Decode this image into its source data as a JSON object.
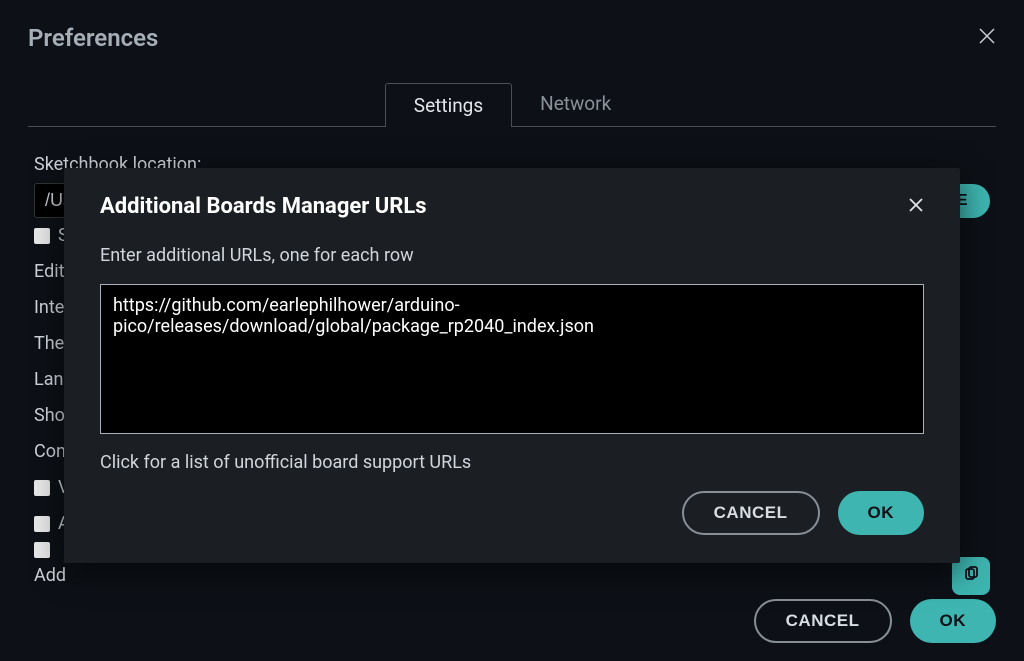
{
  "prefs": {
    "title": "Preferences",
    "tabs": {
      "settings": "Settings",
      "network": "Network"
    },
    "labels": {
      "sketchbook": "Sketchbook location:",
      "sketchbook_value": "/Us",
      "browse": "E",
      "show_files_check": "S",
      "editor": "Edit",
      "interface": "Inte",
      "theme": "The",
      "language": "Lan",
      "show": "Sho",
      "compiler": "Con",
      "v": "V",
      "a": "A",
      "blank": " ",
      "additional": "Add"
    },
    "footer": {
      "cancel": "CANCEL",
      "ok": "OK"
    }
  },
  "modal": {
    "title": "Additional Boards Manager URLs",
    "subtitle": "Enter additional URLs, one for each row",
    "value": "https://github.com/earlephilhower/arduino-pico/releases/download/global/package_rp2040_index.json",
    "link": "Click for a list of unofficial board support URLs",
    "cancel": "CANCEL",
    "ok": "OK"
  }
}
